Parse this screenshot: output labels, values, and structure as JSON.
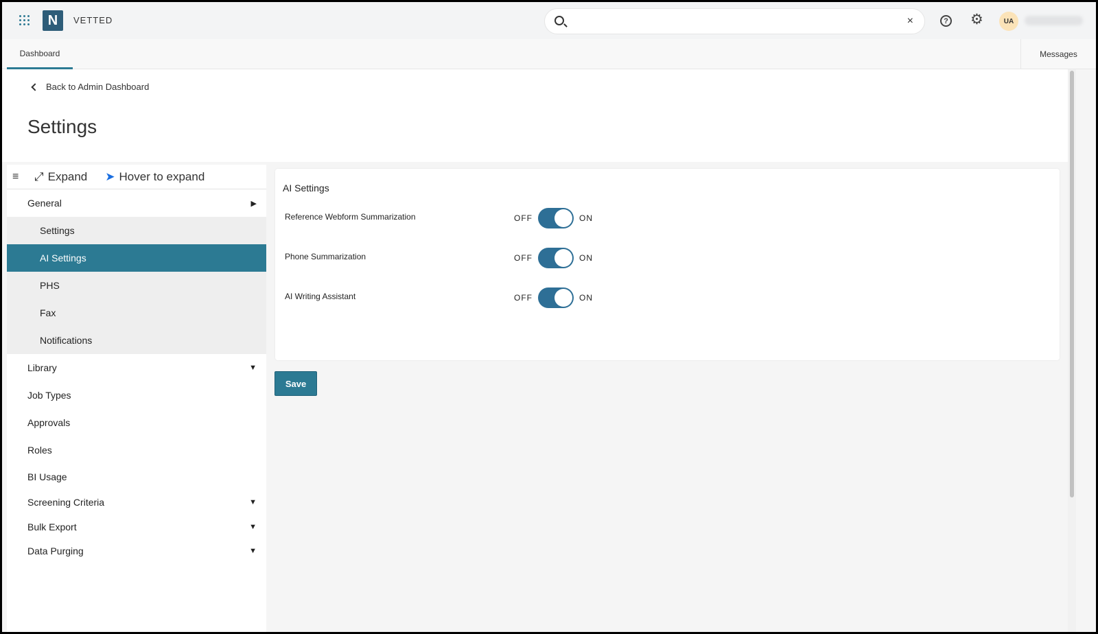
{
  "header": {
    "brand": "VETTED",
    "logo_letter": "N",
    "search": {
      "value": "",
      "clear_label": "×"
    },
    "avatar_initials": "UA",
    "help_label": "?",
    "gear_label": "⚙"
  },
  "tabs": {
    "dashboard": "Dashboard",
    "messages": "Messages"
  },
  "page": {
    "back_label": "Back to Admin Dashboard",
    "title": "Settings"
  },
  "sidebar": {
    "toolbar": {
      "menu_glyph": "≡",
      "expand_glyph": "⤢",
      "expand_label": "Expand",
      "cursor_glyph": "➤",
      "hover_label": "Hover to expand"
    },
    "general": {
      "label": "General",
      "arrow": "▶"
    },
    "general_children": [
      "Settings",
      "AI Settings",
      "PHS",
      "Fax",
      "Notifications"
    ],
    "active_child": "AI Settings",
    "items": [
      {
        "label": "Library",
        "arrow": "▼"
      },
      {
        "label": "Job Types",
        "arrow": ""
      },
      {
        "label": "Approvals",
        "arrow": ""
      },
      {
        "label": "Roles",
        "arrow": ""
      },
      {
        "label": "BI Usage",
        "arrow": ""
      },
      {
        "label": "Screening Criteria",
        "arrow": "▼"
      },
      {
        "label": "Bulk Export",
        "arrow": "▼"
      },
      {
        "label": "Data Purging",
        "arrow": "▼"
      }
    ]
  },
  "ai_settings": {
    "title": "AI Settings",
    "off_label": "OFF",
    "on_label": "ON",
    "rows": [
      {
        "label": "Reference Webform Summarization",
        "enabled": true
      },
      {
        "label": "Phone Summarization",
        "enabled": true
      },
      {
        "label": "AI Writing Assistant",
        "enabled": true
      }
    ]
  },
  "save_label": "Save",
  "colors": {
    "accent": "#2c7a93",
    "toggle_on": "#2e6f96",
    "logo_bg": "#2e5d79"
  }
}
